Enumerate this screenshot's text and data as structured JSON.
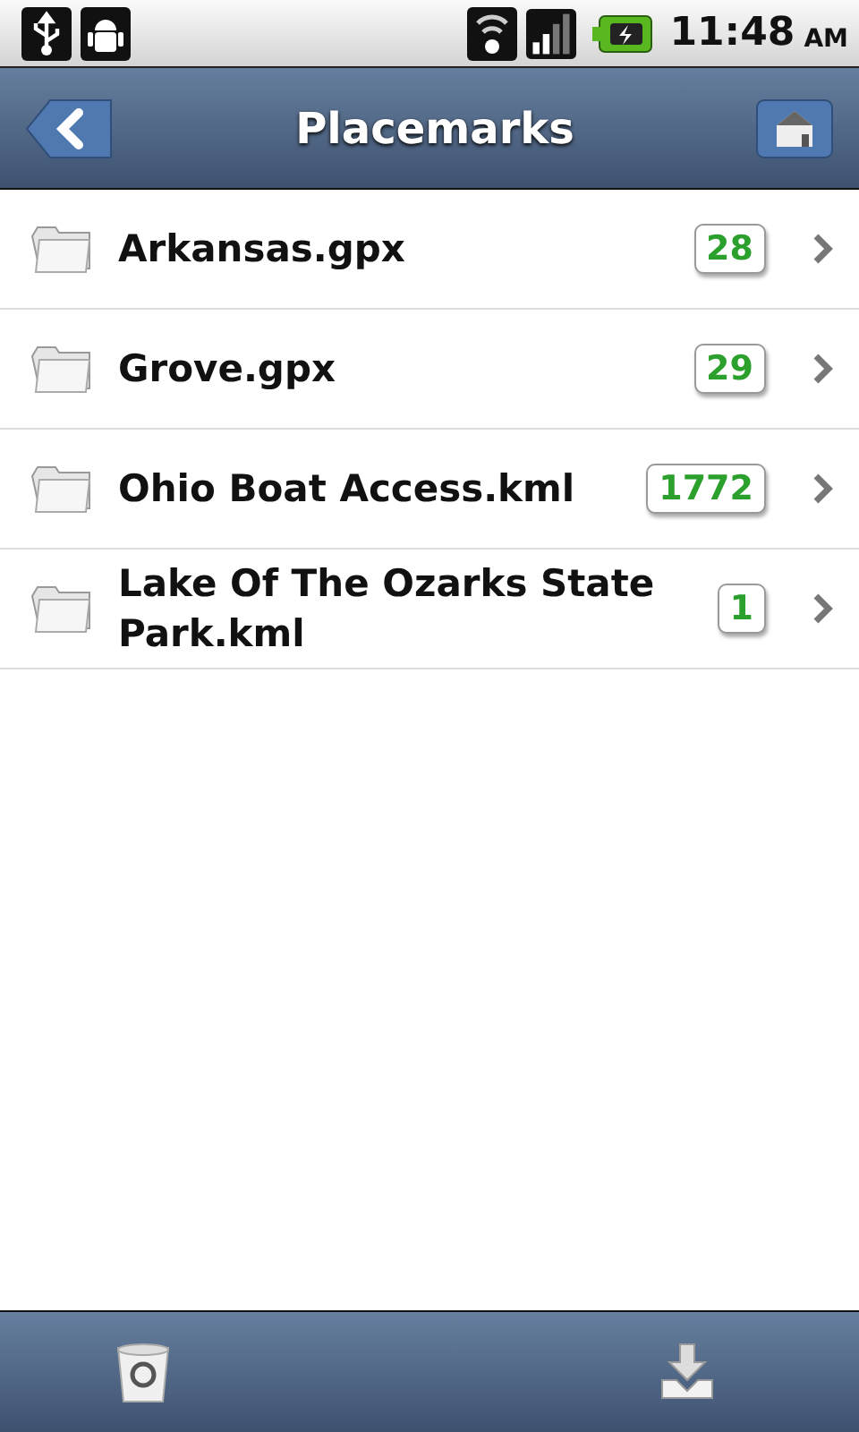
{
  "status_bar": {
    "time": "11:48",
    "ampm": "AM"
  },
  "header": {
    "title": "Placemarks"
  },
  "files": [
    {
      "name": "Arkansas.gpx",
      "count": "28"
    },
    {
      "name": "Grove.gpx",
      "count": "29"
    },
    {
      "name": "Ohio Boat Access.kml",
      "count": "1772"
    },
    {
      "name": "Lake Of The Ozarks State Park.kml",
      "count": "1"
    }
  ]
}
